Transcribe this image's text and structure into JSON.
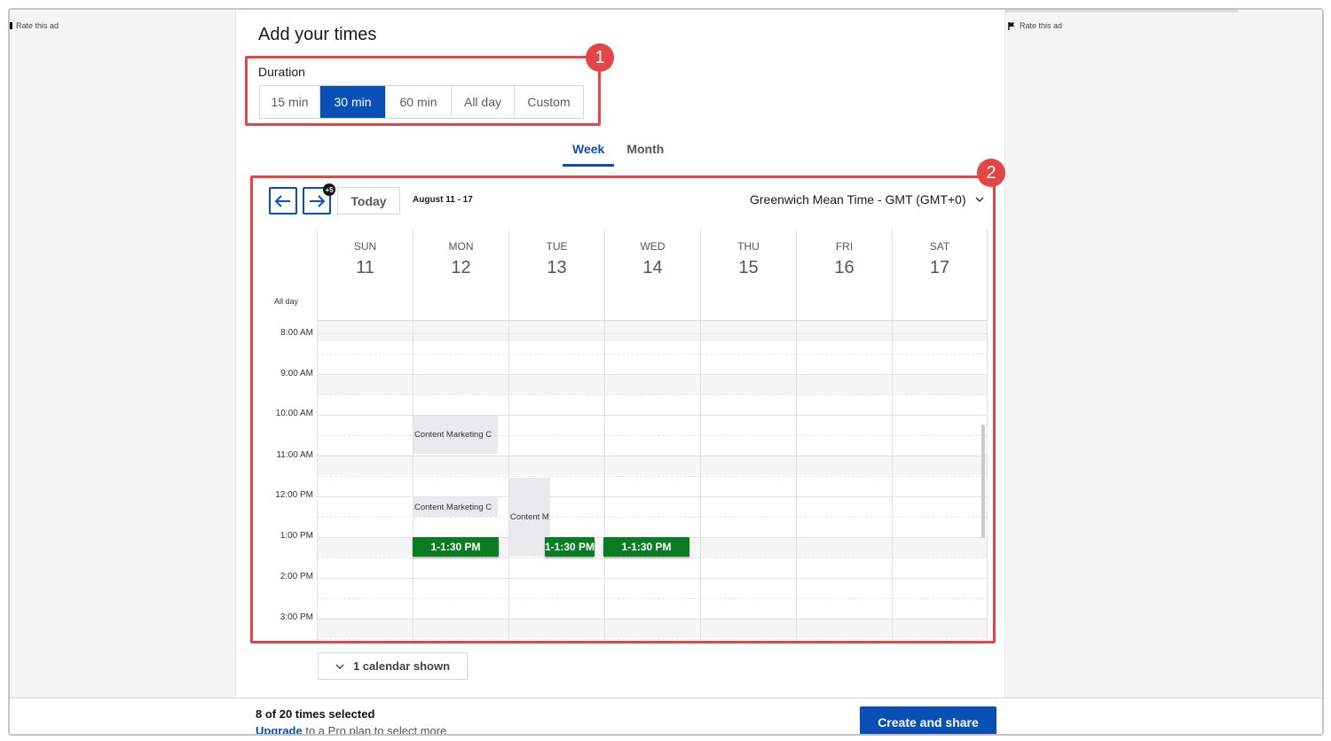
{
  "ads": {
    "left_label": "Rate this ad",
    "right_label": "Rate this ad"
  },
  "header": {
    "title": "Add your times"
  },
  "duration": {
    "label": "Duration",
    "options": [
      "15 min",
      "30 min",
      "60 min",
      "All day",
      "Custom"
    ],
    "selected": "30 min"
  },
  "annotations": {
    "badge1": "1",
    "badge2": "2"
  },
  "view_tabs": {
    "week": "Week",
    "month": "Month",
    "active": "Week"
  },
  "toolbar": {
    "today_label": "Today",
    "more_badge": "+5",
    "date_range": "August 11 - 17",
    "timezone": "Greenwich Mean Time - GMT (GMT+0)"
  },
  "calendar": {
    "allday_label": "All day",
    "days": [
      {
        "dow": "SUN",
        "num": "11"
      },
      {
        "dow": "MON",
        "num": "12"
      },
      {
        "dow": "TUE",
        "num": "13"
      },
      {
        "dow": "WED",
        "num": "14"
      },
      {
        "dow": "THU",
        "num": "15"
      },
      {
        "dow": "FRI",
        "num": "16"
      },
      {
        "dow": "SAT",
        "num": "17"
      }
    ],
    "times": [
      "8:00 AM",
      "9:00 AM",
      "10:00 AM",
      "11:00 AM",
      "12:00 PM",
      "1:00 PM",
      "2:00 PM",
      "3:00 PM"
    ],
    "events": [
      {
        "text": "Content Marketing C"
      },
      {
        "text": "Content Marketing C"
      },
      {
        "text": "Content M"
      }
    ],
    "selected_slots": [
      {
        "text": "1-1:30 PM"
      },
      {
        "text": "1-1:30 PM"
      },
      {
        "text": "1-1:30 PM"
      }
    ],
    "calendars_shown": "1 calendar shown"
  },
  "footer": {
    "selection_count": "8 of 20 times selected",
    "upgrade_link": "Upgrade",
    "upgrade_rest": " to a Pro plan to select more",
    "cta_label": "Create and share"
  },
  "colors": {
    "accent": "#0a4fb5",
    "highlight": "#e64545",
    "selected_slot": "#0a7d24"
  }
}
